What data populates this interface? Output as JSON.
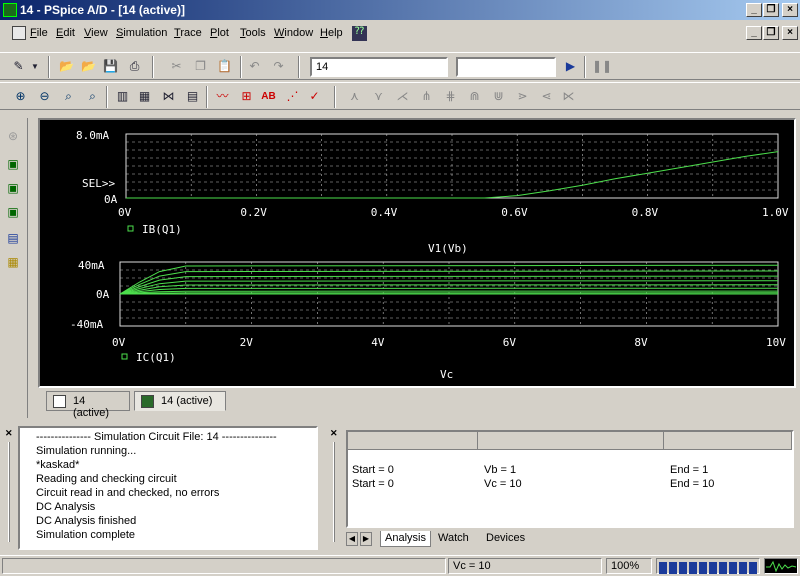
{
  "window": {
    "title": "14 - PSpice A/D  - [14 (active)]"
  },
  "menu": [
    {
      "key": "F",
      "rest": "ile"
    },
    {
      "key": "E",
      "rest": "dit"
    },
    {
      "key": "V",
      "rest": "iew"
    },
    {
      "key": "S",
      "rest": "imulation"
    },
    {
      "key": "T",
      "rest": "race"
    },
    {
      "key": "P",
      "rest": "lot"
    },
    {
      "key": "T",
      "rest": "ools"
    },
    {
      "key": "W",
      "rest": "indow"
    },
    {
      "key": "H",
      "rest": "elp"
    }
  ],
  "toolbar": {
    "profile_value": "14",
    "second_value": ""
  },
  "plots": {
    "top": {
      "y_ticks": [
        "8.0mA",
        "SEL>>",
        "0A"
      ],
      "x_ticks": [
        "0V",
        "0.2V",
        "0.4V",
        "0.6V",
        "0.8V",
        "1.0V"
      ],
      "trace_label": "IB(Q1)",
      "x_label": "V1(Vb)"
    },
    "bottom": {
      "y_ticks": [
        "40mA",
        "0A",
        "-40mA"
      ],
      "x_ticks": [
        "0V",
        "2V",
        "4V",
        "6V",
        "8V",
        "10V"
      ],
      "trace_label": "IC(Q1)",
      "x_label": "Vc"
    },
    "trace_color": "#4ddf4d",
    "grid_color": "#bfbfbf"
  },
  "chart_data": [
    {
      "type": "line",
      "series": [
        {
          "name": "IB(Q1)",
          "x": [
            0,
            0.55,
            0.6,
            0.65,
            0.7,
            0.75,
            0.8,
            0.85,
            0.9,
            0.95,
            1.0
          ],
          "y": [
            0,
            0,
            0.3,
            0.9,
            1.6,
            2.4,
            3.1,
            3.8,
            4.5,
            5.2,
            5.8
          ]
        }
      ],
      "xlabel": "V1(Vb)",
      "ylim": [
        0,
        8
      ]
    },
    {
      "type": "line",
      "series": [
        {
          "name": "IC(Q1)",
          "x": [
            0,
            0.3,
            0.6,
            1.0,
            10
          ],
          "y": [
            0,
            15,
            28,
            35,
            36
          ]
        }
      ],
      "xlabel": "Vc",
      "xlim": [
        0,
        10
      ],
      "ylim": [
        -40,
        40
      ]
    }
  ],
  "doc_tabs": [
    "14 (active)",
    "14 (active)"
  ],
  "output": [
    "--------------- Simulation Circuit File:  14 ---------------",
    "Simulation running...",
    "*kaskad*",
    "Reading and checking circuit",
    "Circuit read in and checked, no errors",
    "DC Analysis",
    "DC Analysis finished",
    "Simulation complete"
  ],
  "sim_status": {
    "rows": [
      {
        "start": "Start = 0",
        "var": "Vb =  1",
        "end": "End = 1"
      },
      {
        "start": "Start = 0",
        "var": "Vc =  10",
        "end": "End = 10"
      }
    ],
    "tabs": [
      "Analysis",
      "Watch",
      "Devices"
    ]
  },
  "status": {
    "value": "Vc = 10",
    "zoom": "100%",
    "progress": 1.0
  }
}
